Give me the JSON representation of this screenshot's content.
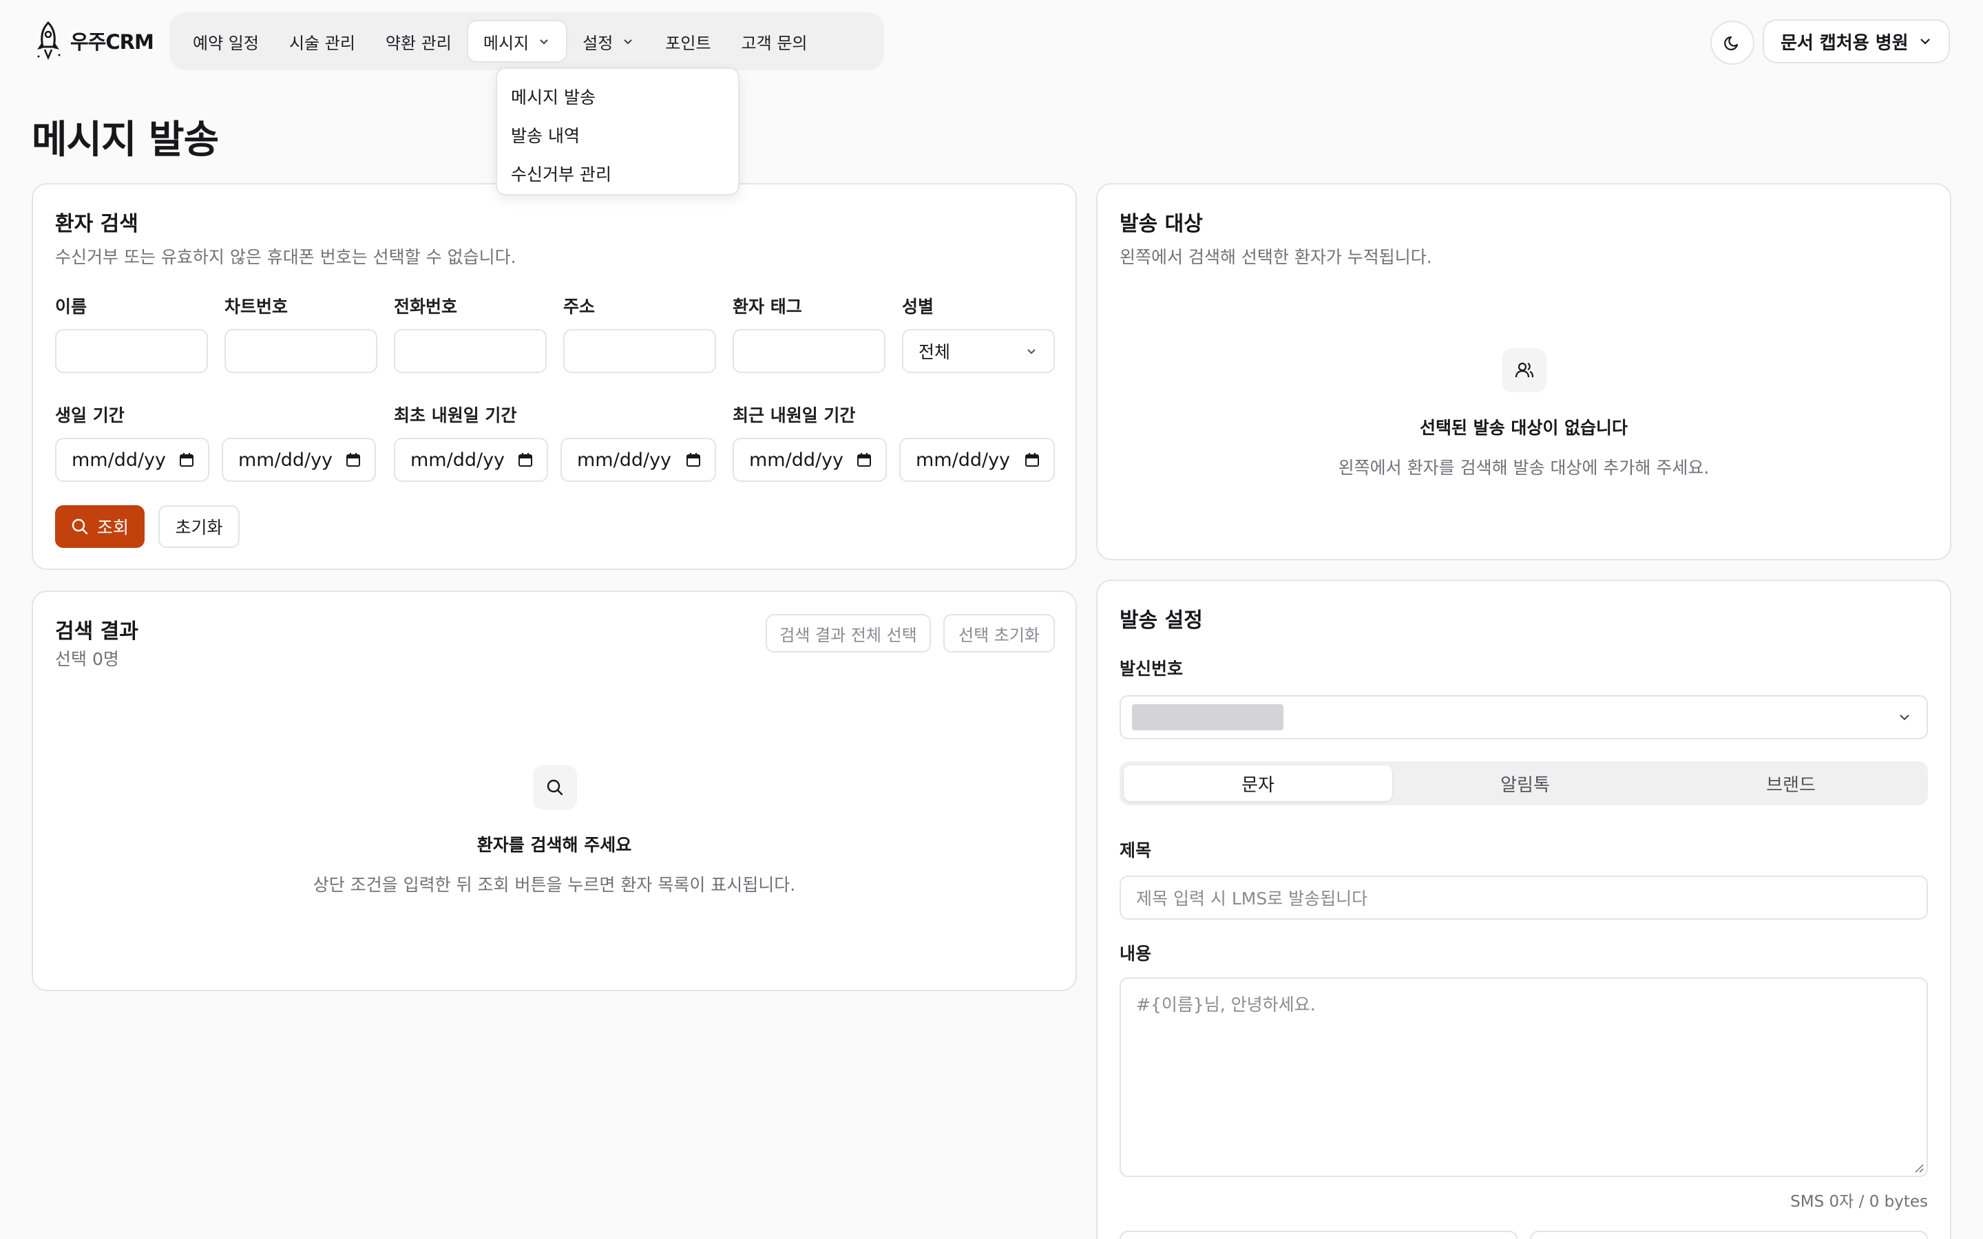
{
  "header": {
    "brand": "우주CRM",
    "nav": [
      {
        "label": "예약 일정"
      },
      {
        "label": "시술 관리"
      },
      {
        "label": "약환 관리"
      },
      {
        "label": "메시지",
        "has_dropdown": true,
        "active": true
      },
      {
        "label": "설정",
        "has_dropdown": true
      },
      {
        "label": "포인트"
      },
      {
        "label": "고객 문의"
      }
    ],
    "theme_icon": "moon-icon",
    "hospital": "문서 캡처용 병원"
  },
  "message_menu": {
    "items": [
      "메시지 발송",
      "발송 내역",
      "수신거부 관리"
    ]
  },
  "page": {
    "title": "메시지 발송"
  },
  "patient_search": {
    "title": "환자 검색",
    "description": "수신거부 또는 유효하지 않은 휴대폰 번호는 선택할 수 없습니다.",
    "fields": {
      "name": {
        "label": "이름",
        "value": ""
      },
      "chart_no": {
        "label": "차트번호",
        "value": ""
      },
      "phone": {
        "label": "전화번호",
        "value": ""
      },
      "address": {
        "label": "주소",
        "value": ""
      },
      "tag": {
        "label": "환자 태그",
        "value": ""
      },
      "gender": {
        "label": "성별",
        "value": "전체"
      }
    },
    "ranges": {
      "birthday": {
        "label": "생일 기간",
        "from": "mm/dd/yy",
        "to": "mm/dd/yy"
      },
      "first_visit": {
        "label": "최초 내원일 기간",
        "from": "mm/dd/yy",
        "to": "mm/dd/yy"
      },
      "last_visit": {
        "label": "최근 내원일 기간",
        "from": "mm/dd/yy",
        "to": "mm/dd/yy"
      }
    },
    "search_button": "조회",
    "reset_button": "초기화"
  },
  "search_results": {
    "title": "검색 결과",
    "selected_count": "선택 0명",
    "select_all_button": "검색 결과 전체 선택",
    "clear_selection_button": "선택 초기화",
    "empty_title": "환자를 검색해 주세요",
    "empty_desc": "상단 조건을 입력한 뒤 조회 버튼을 누르면 환자 목록이 표시됩니다."
  },
  "recipients": {
    "title": "발송 대상",
    "description": "왼쪽에서 검색해 선택한 환자가 누적됩니다.",
    "empty_title": "선택된 발송 대상이 없습니다",
    "empty_desc": "왼쪽에서 환자를 검색해 발송 대상에 추가해 주세요."
  },
  "send_settings": {
    "title": "발송 설정",
    "sender_label": "발신번호",
    "tabs": [
      {
        "label": "문자",
        "active": true
      },
      {
        "label": "알림톡"
      },
      {
        "label": "브랜드"
      }
    ],
    "subject_label": "제목",
    "subject_placeholder": "제목 입력 시 LMS로 발송됩니다",
    "content_label": "내용",
    "content_placeholder": "#{이름}님, 안녕하세요.",
    "counter": "SMS 0자 / 0 bytes"
  },
  "colors": {
    "accent": "#c2410c",
    "border": "#e4e4e7",
    "muted_text": "#71717a",
    "background": "#fafafa"
  }
}
